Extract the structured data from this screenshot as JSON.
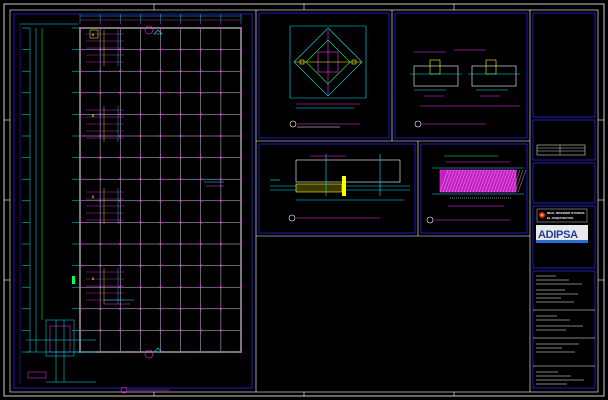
{
  "drawing": {
    "background": "#000000",
    "colors": {
      "frame": "#ffffff",
      "border_blue": "#2a2aff",
      "grid": "#e8e8ff",
      "cyan": "#00e5ff",
      "magenta": "#ff2cff",
      "yellow": "#ffff00",
      "green": "#00ff55",
      "red": "#ff3030"
    },
    "title_block": {
      "company_line1": "REAL INTERIOR STUDIOS",
      "company_line2": "EL ARQUITECTOS",
      "brand": "ADIPSA",
      "brand_colors": [
        "#e62020",
        "#1d3f9e",
        "#2a6fd6",
        "#e8e8e8"
      ]
    },
    "plan_marks": [
      {
        "id": "mark-1",
        "text": "B"
      },
      {
        "id": "mark-2",
        "text": "B"
      },
      {
        "id": "mark-3",
        "text": "B"
      },
      {
        "id": "mark-4",
        "text": "B"
      }
    ]
  }
}
